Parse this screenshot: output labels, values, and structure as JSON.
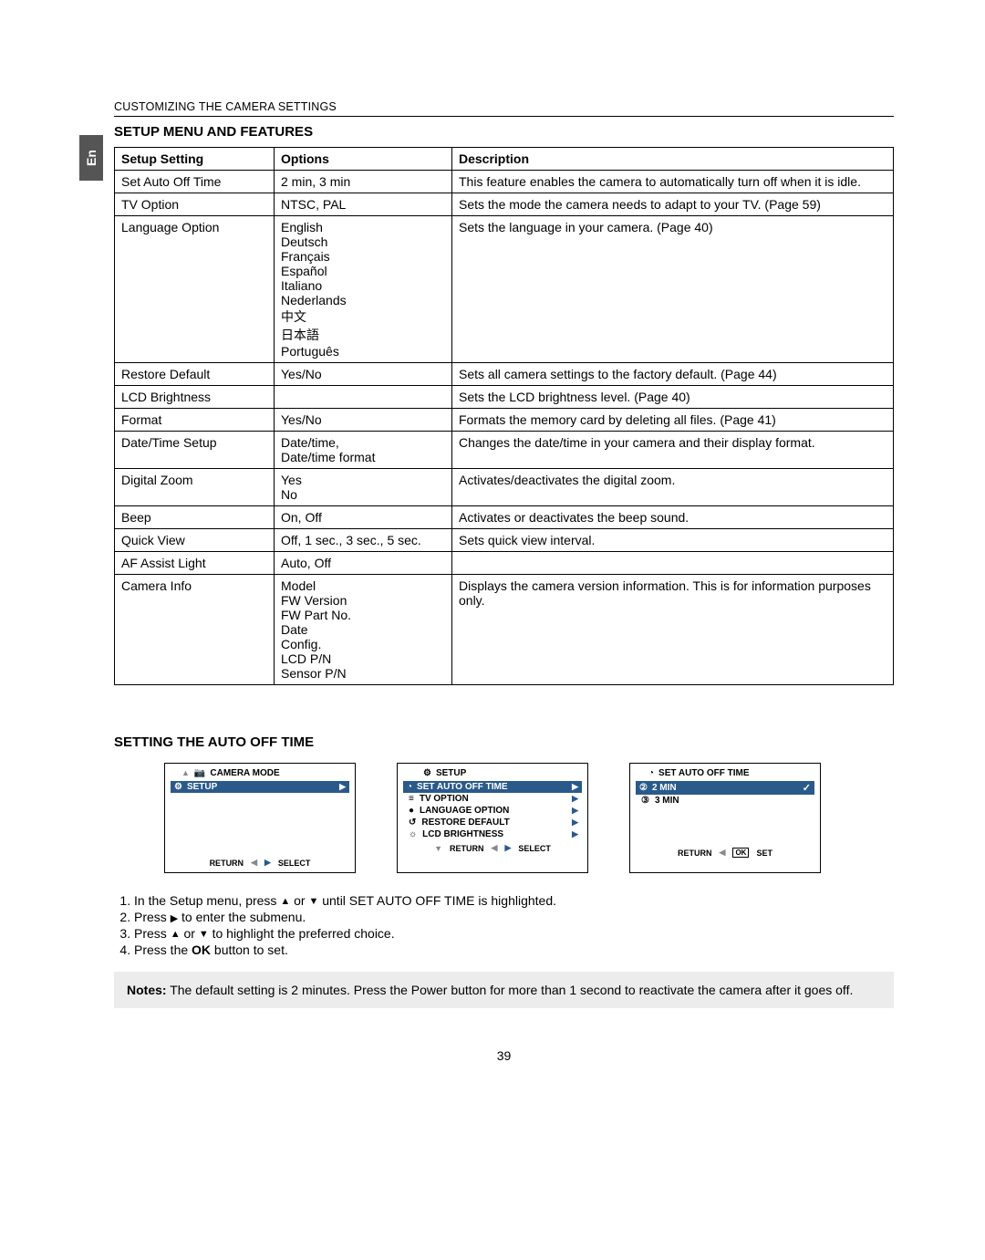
{
  "lang_tab": "En",
  "breadcrumb": "CUSTOMIZING THE CAMERA SETTINGS",
  "heading1": "SETUP MENU AND FEATURES",
  "table": {
    "headers": [
      "Setup Setting",
      "Options",
      "Description"
    ],
    "rows": [
      {
        "setting": "Set Auto Off Time",
        "options": "2 min, 3 min",
        "desc": "This feature enables the camera to automatically turn off when it is idle."
      },
      {
        "setting": "TV Option",
        "options": "NTSC, PAL",
        "desc": "Sets the mode the camera needs to adapt to your TV. (Page 59)"
      },
      {
        "setting": "Language Option",
        "options": "English\nDeutsch\nFrançais\nEspañol\nItaliano\nNederlands\n中文\n日本語\nPortuguês",
        "desc": "Sets the language in your camera. (Page 40)"
      },
      {
        "setting": "Restore Default",
        "options": "Yes/No",
        "desc": "Sets all camera settings to the factory default. (Page 44)"
      },
      {
        "setting": "LCD Brightness",
        "options": "",
        "desc": "Sets the LCD brightness level. (Page 40)"
      },
      {
        "setting": "Format",
        "options": "Yes/No",
        "desc": "Formats the memory card by deleting all files. (Page 41)"
      },
      {
        "setting": "Date/Time Setup",
        "options": "Date/time,\nDate/time format",
        "desc": "Changes the date/time in your camera and their display format."
      },
      {
        "setting": "Digital Zoom",
        "options": "Yes\nNo",
        "desc": "Activates/deactivates the digital zoom."
      },
      {
        "setting": "Beep",
        "options": "On, Off",
        "desc": "Activates or deactivates the beep sound."
      },
      {
        "setting": "Quick View",
        "options": "Off, 1 sec., 3 sec., 5 sec.",
        "desc": "Sets quick view interval."
      },
      {
        "setting": "AF Assist Light",
        "options": "Auto, Off",
        "desc": ""
      },
      {
        "setting": "Camera Info",
        "options": "Model\nFW Version\nFW Part No.\nDate\nConfig.\nLCD P/N\nSensor P/N",
        "desc": "Displays the camera version information. This is for information purposes only."
      }
    ]
  },
  "heading2": "SETTING THE AUTO OFF TIME",
  "screen1": {
    "title_icon": "camera-icon",
    "title": "CAMERA MODE",
    "highlight": "SETUP",
    "footer_return": "RETURN",
    "footer_select": "SELECT"
  },
  "screen2": {
    "title": "SETUP",
    "items": [
      "SET AUTO OFF TIME",
      "TV OPTION",
      "LANGUAGE OPTION",
      "RESTORE DEFAULT",
      "LCD BRIGHTNESS"
    ],
    "footer_return": "RETURN",
    "footer_select": "SELECT"
  },
  "screen3": {
    "title": "SET AUTO OFF TIME",
    "items": [
      "2 MIN",
      "3 MIN"
    ],
    "footer_return": "RETURN",
    "footer_set": "SET",
    "footer_ok": "OK"
  },
  "steps": [
    {
      "pre": "In the Setup menu, press ",
      "icons": [
        "▲",
        " or ",
        "▼"
      ],
      "post": " until SET AUTO OFF TIME is highlighted."
    },
    {
      "pre": "Press ",
      "icons": [
        "▶"
      ],
      "post": " to enter the submenu."
    },
    {
      "pre": "Press ",
      "icons": [
        "▲",
        " or ",
        "▼"
      ],
      "post": " to highlight the preferred choice."
    },
    {
      "pre": "Press the ",
      "bold": "OK",
      "post": " button to set."
    }
  ],
  "notes_label": "Notes:",
  "notes_text": " The default setting is 2 minutes. Press the Power button for more than 1 second to reactivate the camera after it goes off.",
  "page_number": "39"
}
